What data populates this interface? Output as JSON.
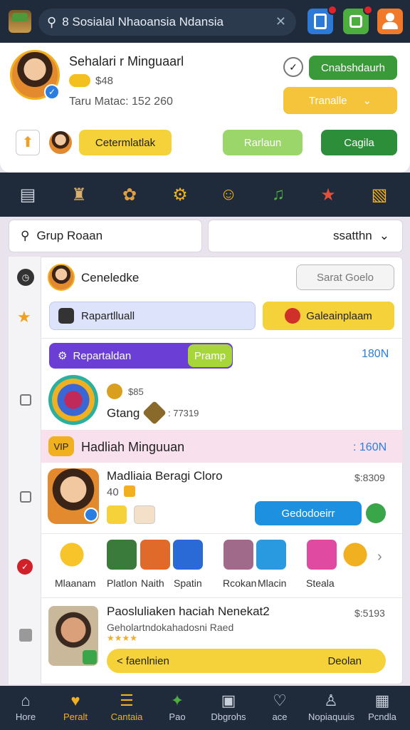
{
  "topbar": {
    "search_text": "8 Sosialal Nhaoansia Ndansia",
    "colors": {
      "bg": "#1f2a3a",
      "accent": "#f0b020",
      "green": "#3a9a3a"
    },
    "icons": [
      "search-icon",
      "clear-icon",
      "video-icon",
      "puzzle-icon",
      "user-icon"
    ]
  },
  "profile": {
    "name": "Sehalari r Minguaarl",
    "coins": "$48",
    "subline": "Taru Matac: 152 260",
    "primary_button": "Cnabshdaurh",
    "secondary_button": "Tranalle",
    "tag_label": "Cetermlatlak",
    "mid_button": "Rarlaun",
    "right_button": "Cagila"
  },
  "icon_row": [
    "briefcase-icon",
    "castle-icon",
    "gear-flower-icon",
    "sun-gear-icon",
    "smiley-icon",
    "music-icon",
    "gift-icon",
    "chest-icon"
  ],
  "filters": {
    "search_label": "Grup Roaan",
    "select_label": "ssatthn"
  },
  "rows": {
    "row1_name": "Ceneledke",
    "row1_button": "Sarat Goelo",
    "row1_left_chip": "Rapartlluall",
    "row1_right_chip": "Galeainplaam",
    "promo_label": "Repartaldan",
    "promo_badge": "Pramp",
    "promo_value": "180N",
    "game_price": "$85",
    "game_title": "Gtang",
    "game_score": ": 77319",
    "banner_label": "Hadliah Minguuan",
    "banner_value": ": 160N",
    "item2_title": "Madliaia Beragi Cloro",
    "item2_count": "40",
    "item2_price": "$:8309",
    "tooltip": "Gedodoeirr",
    "carousel": [
      "Mlaanam",
      "Platlon",
      "Naith",
      "Spatin",
      "Rcokan",
      "Mlacin",
      "Steala"
    ],
    "item3_title": "Paosluliaken haciah Nenekat2",
    "item3_sub": "Geholartndokahadosni Raed",
    "item3_price": "$:5193",
    "item3_left": "< faenlnien",
    "item3_right": "Deolan"
  },
  "bottom_nav": [
    "Hore",
    "Peralt",
    "Cantaia",
    "Pao",
    "Dbgrohs",
    "ace",
    "Nopiaquuis",
    "Pcndla"
  ]
}
